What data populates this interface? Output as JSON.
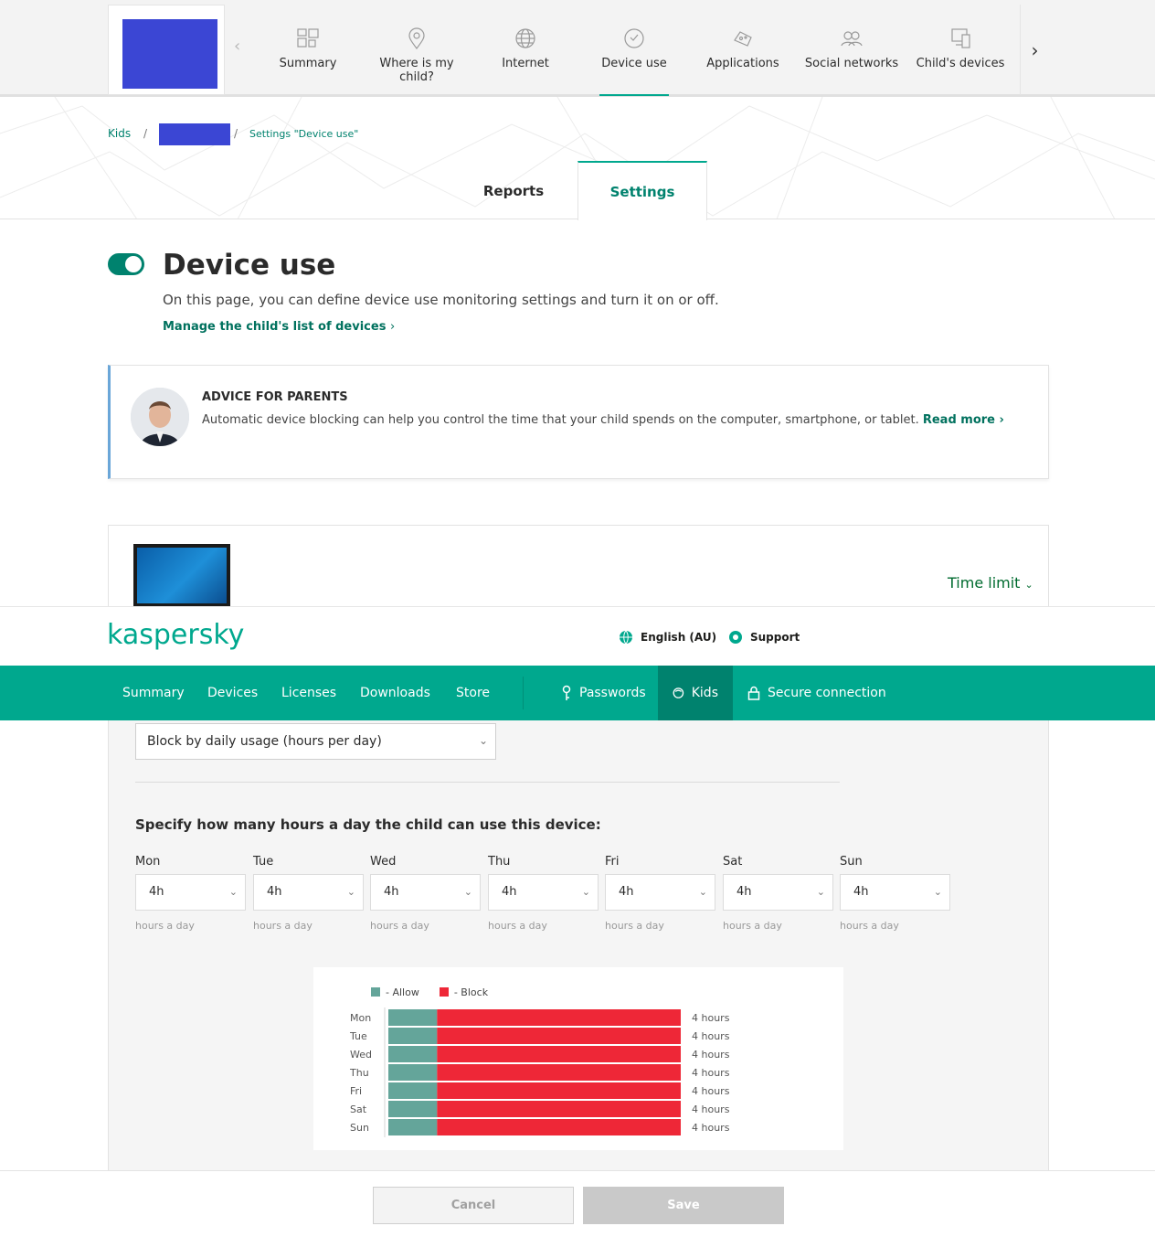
{
  "kids_nav": {
    "tabs": [
      {
        "label": "Summary",
        "icon": "summary-icon"
      },
      {
        "label": "Where is my child?",
        "icon": "location-pin-icon"
      },
      {
        "label": "Internet",
        "icon": "globe-icon"
      },
      {
        "label": "Device use",
        "icon": "clock-icon",
        "active": true
      },
      {
        "label": "Applications",
        "icon": "gamepad-icon"
      },
      {
        "label": "Social networks",
        "icon": "people-icon"
      },
      {
        "label": "Child's devices",
        "icon": "devices-icon"
      }
    ]
  },
  "breadcrumb": {
    "root": "Kids",
    "sep": "/",
    "current": "Settings \"Device use\""
  },
  "sub_tabs": {
    "reports": "Reports",
    "settings": "Settings"
  },
  "section": {
    "title": "Device use",
    "description": "On this page, you can define device use monitoring settings and turn it on or off.",
    "manage_link": "Manage the child's list of devices",
    "enabled": true
  },
  "advice": {
    "title": "ADVICE FOR PARENTS",
    "text": "Automatic device blocking can help you control the time that your child spends on the computer, smartphone, or tablet.",
    "read_more": "Read more"
  },
  "device": {
    "time_limit_label": "Time limit",
    "mode": "Block by daily usage (hours per day)",
    "hours_heading": "Specify how many hours a day the child can use this device:",
    "unit_label": "hours a day",
    "days": [
      {
        "name": "Mon",
        "value": "4h"
      },
      {
        "name": "Tue",
        "value": "4h"
      },
      {
        "name": "Wed",
        "value": "4h"
      },
      {
        "name": "Thu",
        "value": "4h"
      },
      {
        "name": "Fri",
        "value": "4h"
      },
      {
        "name": "Sat",
        "value": "4h"
      },
      {
        "name": "Sun",
        "value": "4h"
      }
    ]
  },
  "header": {
    "logo": "kaspersky",
    "language": "English (AU)",
    "support": "Support"
  },
  "main_nav": {
    "items": [
      "Summary",
      "Devices",
      "Licenses",
      "Downloads",
      "Store"
    ],
    "passwords": "Passwords",
    "kids": "Kids",
    "secure": "Secure connection"
  },
  "chart_data": {
    "type": "bar",
    "stacked": true,
    "orientation": "horizontal",
    "categories": [
      "Mon",
      "Tue",
      "Wed",
      "Thu",
      "Fri",
      "Sat",
      "Sun"
    ],
    "series": [
      {
        "name": "- Allow",
        "color": "#64a59a",
        "values": [
          4,
          4,
          4,
          4,
          4,
          4,
          4
        ]
      },
      {
        "name": "- Block",
        "color": "#ee2737",
        "values": [
          20,
          20,
          20,
          20,
          20,
          20,
          20
        ]
      }
    ],
    "value_labels": [
      "4 hours",
      "4 hours",
      "4 hours",
      "4 hours",
      "4 hours",
      "4 hours",
      "4 hours"
    ],
    "xlim": [
      0,
      24
    ],
    "legend": "top-left"
  },
  "footer": {
    "cancel": "Cancel",
    "save": "Save"
  },
  "colors": {
    "accent": "#00a88e",
    "accent_dark": "#00826e",
    "child_avatar": "#3b46d4"
  }
}
